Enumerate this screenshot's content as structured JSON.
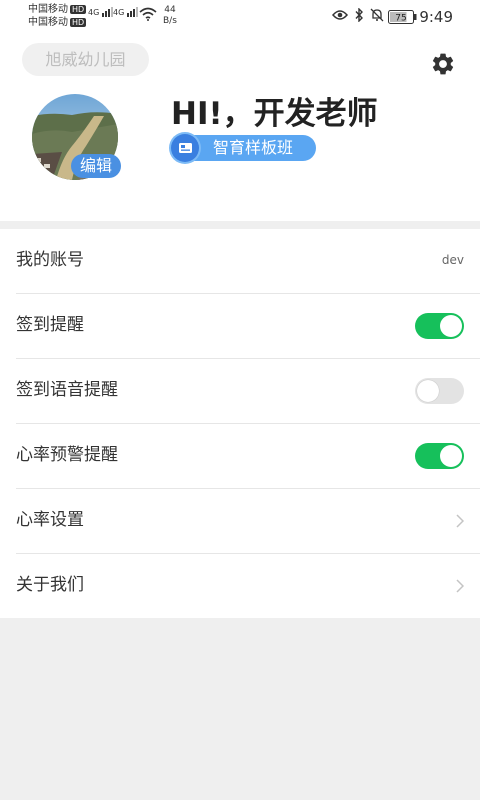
{
  "status_bar": {
    "carrier1": "中国移动",
    "carrier2": "中国移动",
    "hd": "HD",
    "net1": "4G",
    "net2": "4G",
    "speed_value": "44",
    "speed_unit": "B/s",
    "battery": "75",
    "time": "9:49"
  },
  "header": {
    "school_name": "旭威幼儿园",
    "greeting": "HI!，开发老师",
    "edit_label": "编辑",
    "class_name": "智育样板班"
  },
  "menu": {
    "account": {
      "label": "我的账号",
      "value": "dev"
    },
    "checkin_reminder": {
      "label": "签到提醒",
      "enabled": true
    },
    "checkin_voice": {
      "label": "签到语音提醒",
      "enabled": false
    },
    "hr_warning": {
      "label": "心率预警提醒",
      "enabled": true
    },
    "hr_settings": {
      "label": "心率设置"
    },
    "about": {
      "label": "关于我们"
    }
  },
  "colors": {
    "toggle_on": "#16c05b",
    "toggle_off": "#e3e3e3",
    "accent": "#4a90e2"
  },
  "icons": [
    "settings-gear-icon",
    "eye-icon",
    "bluetooth-icon",
    "bell-off-icon",
    "wifi-icon",
    "chevron-right-icon"
  ]
}
